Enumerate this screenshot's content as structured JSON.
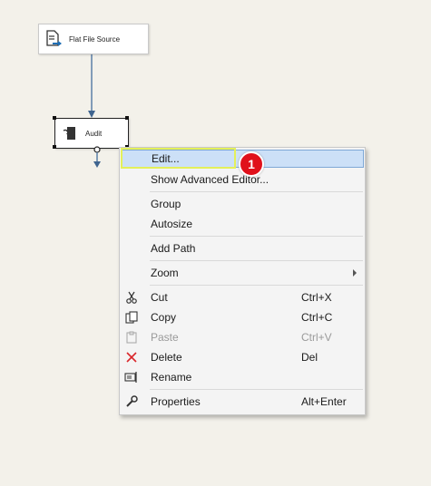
{
  "canvas": {
    "nodes": [
      {
        "label": "Flat File Source",
        "icon": "flat-file-source-icon"
      },
      {
        "label": "Audit",
        "icon": "audit-icon"
      }
    ]
  },
  "context_menu": {
    "items": [
      {
        "label": "Edit...",
        "highlighted": true
      },
      {
        "label": "Show Advanced Editor..."
      },
      {
        "label": "Group"
      },
      {
        "label": "Autosize"
      },
      {
        "label": "Add Path"
      },
      {
        "label": "Zoom",
        "submenu": true
      },
      {
        "label": "Cut",
        "shortcut": "Ctrl+X",
        "icon": "scissors-icon"
      },
      {
        "label": "Copy",
        "shortcut": "Ctrl+C",
        "icon": "copy-icon"
      },
      {
        "label": "Paste",
        "shortcut": "Ctrl+V",
        "icon": "paste-icon",
        "disabled": true
      },
      {
        "label": "Delete",
        "shortcut": "Del",
        "icon": "delete-icon"
      },
      {
        "label": "Rename",
        "icon": "rename-icon"
      },
      {
        "label": "Properties",
        "shortcut": "Alt+Enter",
        "icon": "wrench-icon"
      }
    ]
  },
  "callout": {
    "number": "1"
  },
  "colors": {
    "highlight": "#cce0f7",
    "callout_badge": "#e0111b",
    "callout_outline": "#e4f05a",
    "connector": "#5b7fa8"
  }
}
